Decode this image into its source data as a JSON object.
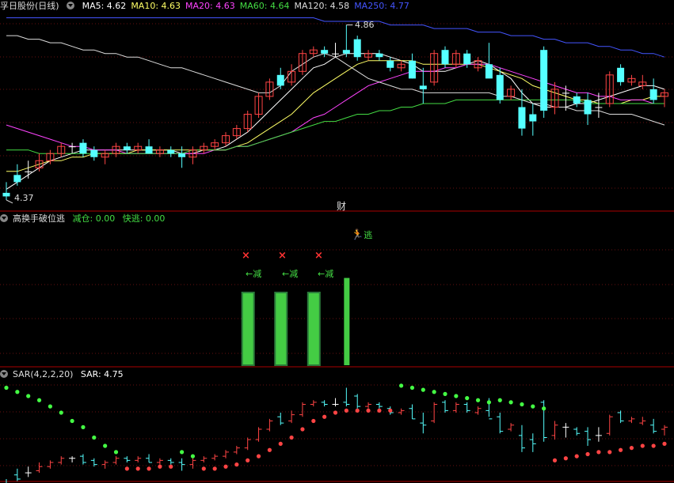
{
  "header1": {
    "title": "孚日股份(日线)",
    "ma": [
      {
        "label": "MA5: 4.62",
        "color": "#ffffff"
      },
      {
        "label": "MA10: 4.63",
        "color": "#ffff66"
      },
      {
        "label": "MA20: 4.63",
        "color": "#ff44ff"
      },
      {
        "label": "MA60: 4.64",
        "color": "#44dd44"
      },
      {
        "label": "MA120: 4.58",
        "color": "#dddddd"
      },
      {
        "label": "MA250: 4.77",
        "color": "#4455ff"
      }
    ]
  },
  "price_chart": {
    "high_label": "4.86",
    "low_label": "4.37",
    "marker_label": "财"
  },
  "header2": {
    "title": "高换手破位逃",
    "items": [
      {
        "label": "减仓: 0.00",
        "color": "#44dd44"
      },
      {
        "label": "快逃: 0.00",
        "color": "#44dd44"
      }
    ]
  },
  "indicator": {
    "escape_label": "逃",
    "reduce_label": "←减",
    "cross_symbol": "×"
  },
  "header3": {
    "title": "SAR(4,2,2,20)",
    "value_label": "SAR: 4.75"
  },
  "colors": {
    "up": "#ff4444",
    "down": "#55ffff",
    "flat": "#ffffff",
    "green": "#44cc44",
    "divider": "#aa0000"
  },
  "chart_data": {
    "type": "candlestick",
    "ohlc": [
      [
        4.39,
        4.42,
        4.37,
        4.38
      ],
      [
        4.44,
        4.47,
        4.41,
        4.42
      ],
      [
        4.45,
        4.48,
        4.43,
        4.45
      ],
      [
        4.46,
        4.5,
        4.45,
        4.48
      ],
      [
        4.48,
        4.51,
        4.47,
        4.5
      ],
      [
        4.5,
        4.53,
        4.49,
        4.52
      ],
      [
        4.52,
        4.53,
        4.5,
        4.52
      ],
      [
        4.53,
        4.54,
        4.49,
        4.5
      ],
      [
        4.51,
        4.52,
        4.48,
        4.49
      ],
      [
        4.49,
        4.51,
        4.47,
        4.5
      ],
      [
        4.5,
        4.53,
        4.49,
        4.52
      ],
      [
        4.52,
        4.53,
        4.5,
        4.51
      ],
      [
        4.51,
        4.53,
        4.5,
        4.52
      ],
      [
        4.52,
        4.54,
        4.5,
        4.5
      ],
      [
        4.5,
        4.52,
        4.49,
        4.51
      ],
      [
        4.51,
        4.52,
        4.49,
        4.5
      ],
      [
        4.5,
        4.52,
        4.46,
        4.49
      ],
      [
        4.49,
        4.52,
        4.47,
        4.51
      ],
      [
        4.51,
        4.53,
        4.5,
        4.52
      ],
      [
        4.52,
        4.54,
        4.51,
        4.53
      ],
      [
        4.53,
        4.56,
        4.52,
        4.55
      ],
      [
        4.55,
        4.58,
        4.54,
        4.57
      ],
      [
        4.57,
        4.62,
        4.56,
        4.61
      ],
      [
        4.61,
        4.67,
        4.6,
        4.66
      ],
      [
        4.66,
        4.71,
        4.65,
        4.7
      ],
      [
        4.72,
        4.74,
        4.68,
        4.69
      ],
      [
        4.7,
        4.75,
        4.69,
        4.73
      ],
      [
        4.73,
        4.79,
        4.72,
        4.78
      ],
      [
        4.78,
        4.8,
        4.77,
        4.79
      ],
      [
        4.79,
        4.8,
        4.77,
        4.78
      ],
      [
        4.78,
        4.81,
        4.77,
        4.78
      ],
      [
        4.79,
        4.86,
        4.77,
        4.78
      ],
      [
        4.82,
        4.83,
        4.76,
        4.77
      ],
      [
        4.77,
        4.79,
        4.76,
        4.78
      ],
      [
        4.78,
        4.79,
        4.76,
        4.77
      ],
      [
        4.76,
        4.77,
        4.73,
        4.74
      ],
      [
        4.74,
        4.76,
        4.73,
        4.75
      ],
      [
        4.76,
        4.78,
        4.71,
        4.71
      ],
      [
        4.69,
        4.74,
        4.64,
        4.68
      ],
      [
        4.7,
        4.79,
        4.69,
        4.78
      ],
      [
        4.79,
        4.8,
        4.74,
        4.75
      ],
      [
        4.75,
        4.79,
        4.74,
        4.78
      ],
      [
        4.78,
        4.79,
        4.74,
        4.75
      ],
      [
        4.74,
        4.77,
        4.73,
        4.76
      ],
      [
        4.75,
        4.81,
        4.72,
        4.71
      ],
      [
        4.72,
        4.74,
        4.64,
        4.65
      ],
      [
        4.66,
        4.69,
        4.65,
        4.68
      ],
      [
        4.63,
        4.68,
        4.55,
        4.57
      ],
      [
        4.61,
        4.64,
        4.55,
        4.59
      ],
      [
        4.79,
        4.8,
        4.6,
        4.62
      ],
      [
        4.63,
        4.7,
        4.61,
        4.68
      ],
      [
        4.67,
        4.69,
        4.62,
        4.67
      ],
      [
        4.66,
        4.67,
        4.63,
        4.64
      ],
      [
        4.65,
        4.67,
        4.58,
        4.61
      ],
      [
        4.63,
        4.67,
        4.6,
        4.63
      ],
      [
        4.64,
        4.73,
        4.63,
        4.72
      ],
      [
        4.74,
        4.75,
        4.69,
        4.7
      ],
      [
        4.7,
        4.72,
        4.69,
        4.71
      ],
      [
        4.69,
        4.72,
        4.68,
        4.7
      ],
      [
        4.68,
        4.71,
        4.64,
        4.65
      ],
      [
        4.66,
        4.68,
        4.63,
        4.67
      ]
    ],
    "ma": {
      "MA5": [
        4.4,
        4.42,
        4.44,
        4.46,
        4.48,
        4.49,
        4.5,
        4.51,
        4.51,
        4.51,
        4.51,
        4.51,
        4.51,
        4.51,
        4.51,
        4.51,
        4.5,
        4.5,
        4.51,
        4.51,
        4.52,
        4.54,
        4.56,
        4.59,
        4.62,
        4.65,
        4.68,
        4.71,
        4.74,
        4.75,
        4.77,
        4.78,
        4.78,
        4.78,
        4.78,
        4.77,
        4.76,
        4.75,
        4.73,
        4.73,
        4.73,
        4.74,
        4.75,
        4.76,
        4.75,
        4.73,
        4.71,
        4.67,
        4.64,
        4.63,
        4.63,
        4.63,
        4.64,
        4.64,
        4.65,
        4.66,
        4.67,
        4.68,
        4.69,
        4.69,
        4.68
      ],
      "MA10": [
        4.45,
        4.45,
        4.46,
        4.47,
        4.48,
        4.48,
        4.49,
        4.49,
        4.5,
        4.5,
        4.5,
        4.5,
        4.51,
        4.51,
        4.51,
        4.51,
        4.51,
        4.51,
        4.51,
        4.51,
        4.51,
        4.52,
        4.53,
        4.55,
        4.57,
        4.59,
        4.61,
        4.64,
        4.67,
        4.69,
        4.71,
        4.73,
        4.75,
        4.76,
        4.76,
        4.76,
        4.76,
        4.76,
        4.75,
        4.75,
        4.75,
        4.75,
        4.75,
        4.75,
        4.74,
        4.73,
        4.72,
        4.71,
        4.69,
        4.68,
        4.67,
        4.66,
        4.65,
        4.65,
        4.64,
        4.64,
        4.64,
        4.65,
        4.65,
        4.66,
        4.66
      ],
      "MA20": [
        4.58,
        4.57,
        4.56,
        4.55,
        4.54,
        4.53,
        4.52,
        4.52,
        4.51,
        4.51,
        4.51,
        4.5,
        4.5,
        4.5,
        4.5,
        4.5,
        4.5,
        4.5,
        4.5,
        4.51,
        4.51,
        4.52,
        4.52,
        4.53,
        4.54,
        4.55,
        4.56,
        4.58,
        4.6,
        4.61,
        4.63,
        4.65,
        4.67,
        4.69,
        4.7,
        4.71,
        4.72,
        4.73,
        4.73,
        4.73,
        4.74,
        4.74,
        4.75,
        4.75,
        4.75,
        4.74,
        4.73,
        4.72,
        4.71,
        4.7,
        4.69,
        4.68,
        4.67,
        4.67,
        4.66,
        4.66,
        4.65,
        4.65,
        4.65,
        4.64,
        4.64
      ],
      "MA60": [
        4.51,
        4.51,
        4.51,
        4.5,
        4.5,
        4.5,
        4.5,
        4.5,
        4.5,
        4.5,
        4.5,
        4.5,
        4.5,
        4.5,
        4.5,
        4.5,
        4.5,
        4.51,
        4.51,
        4.51,
        4.51,
        4.52,
        4.52,
        4.53,
        4.54,
        4.55,
        4.56,
        4.57,
        4.58,
        4.59,
        4.59,
        4.6,
        4.61,
        4.61,
        4.62,
        4.62,
        4.63,
        4.63,
        4.64,
        4.64,
        4.64,
        4.65,
        4.65,
        4.65,
        4.65,
        4.65,
        4.65,
        4.65,
        4.65,
        4.65,
        4.65,
        4.65,
        4.65,
        4.64,
        4.64,
        4.64,
        4.64,
        4.64,
        4.64,
        4.64,
        4.64
      ],
      "MA120": [
        4.83,
        4.83,
        4.82,
        4.82,
        4.81,
        4.81,
        4.8,
        4.79,
        4.79,
        4.78,
        4.78,
        4.77,
        4.77,
        4.76,
        4.75,
        4.74,
        4.74,
        4.73,
        4.72,
        4.71,
        4.7,
        4.69,
        4.68,
        4.67,
        4.67,
        4.69,
        4.73,
        4.75,
        4.77,
        4.78,
        4.77,
        4.75,
        4.73,
        4.71,
        4.7,
        4.69,
        4.68,
        4.68,
        4.67,
        4.67,
        4.67,
        4.67,
        4.67,
        4.67,
        4.67,
        4.66,
        4.66,
        4.65,
        4.64,
        4.64,
        4.63,
        4.63,
        4.62,
        4.62,
        4.62,
        4.61,
        4.61,
        4.61,
        4.6,
        4.59,
        4.58
      ],
      "MA250": [
        4.88,
        4.88,
        4.88,
        4.88,
        4.88,
        4.88,
        4.88,
        4.88,
        4.88,
        4.88,
        4.88,
        4.88,
        4.88,
        4.88,
        4.88,
        4.88,
        4.88,
        4.88,
        4.88,
        4.88,
        4.88,
        4.88,
        4.88,
        4.88,
        4.88,
        4.88,
        4.88,
        4.88,
        4.88,
        4.87,
        4.87,
        4.87,
        4.87,
        4.87,
        4.87,
        4.86,
        4.86,
        4.86,
        4.86,
        4.85,
        4.85,
        4.85,
        4.85,
        4.84,
        4.84,
        4.84,
        4.83,
        4.83,
        4.83,
        4.82,
        4.82,
        4.81,
        4.81,
        4.81,
        4.8,
        4.8,
        4.79,
        4.79,
        4.78,
        4.78,
        4.77
      ]
    },
    "indicator_bars": [
      {
        "index": 22,
        "value": 1.0,
        "type": "reduce"
      },
      {
        "index": 25,
        "value": 1.0,
        "type": "reduce"
      },
      {
        "index": 28,
        "value": 1.0,
        "type": "reduce"
      },
      {
        "index": 31,
        "value": 1.2,
        "type": "escape"
      }
    ],
    "sar": [
      [
        4.86,
        "d"
      ],
      [
        4.84,
        "d"
      ],
      [
        4.82,
        "d"
      ],
      [
        4.8,
        "d"
      ],
      [
        4.77,
        "d"
      ],
      [
        4.74,
        "d"
      ],
      [
        4.7,
        "d"
      ],
      [
        4.67,
        "d"
      ],
      [
        4.62,
        "d"
      ],
      [
        4.58,
        "d"
      ],
      [
        4.55,
        "d"
      ],
      [
        4.47,
        "u"
      ],
      [
        4.47,
        "u"
      ],
      [
        4.47,
        "u"
      ],
      [
        4.48,
        "u"
      ],
      [
        4.48,
        "u"
      ],
      [
        4.55,
        "d"
      ],
      [
        4.53,
        "d"
      ],
      [
        4.47,
        "u"
      ],
      [
        4.47,
        "u"
      ],
      [
        4.48,
        "u"
      ],
      [
        4.49,
        "u"
      ],
      [
        4.51,
        "u"
      ],
      [
        4.53,
        "u"
      ],
      [
        4.56,
        "u"
      ],
      [
        4.59,
        "u"
      ],
      [
        4.62,
        "u"
      ],
      [
        4.66,
        "u"
      ],
      [
        4.7,
        "u"
      ],
      [
        4.72,
        "u"
      ],
      [
        4.74,
        "u"
      ],
      [
        4.75,
        "u"
      ],
      [
        4.75,
        "u"
      ],
      [
        4.75,
        "u"
      ],
      [
        4.75,
        "u"
      ],
      [
        4.75,
        "u"
      ],
      [
        4.87,
        "d"
      ],
      [
        4.86,
        "d"
      ],
      [
        4.85,
        "d"
      ],
      [
        4.84,
        "d"
      ],
      [
        4.83,
        "d"
      ],
      [
        4.82,
        "d"
      ],
      [
        4.81,
        "d"
      ],
      [
        4.8,
        "d"
      ],
      [
        4.79,
        "d"
      ],
      [
        4.8,
        "d"
      ],
      [
        4.79,
        "d"
      ],
      [
        4.78,
        "d"
      ],
      [
        4.77,
        "d"
      ],
      [
        4.76,
        "d"
      ],
      [
        4.51,
        "u"
      ],
      [
        4.52,
        "u"
      ],
      [
        4.53,
        "u"
      ],
      [
        4.54,
        "u"
      ],
      [
        4.55,
        "u"
      ],
      [
        4.55,
        "u"
      ],
      [
        4.56,
        "u"
      ],
      [
        4.57,
        "u"
      ],
      [
        4.58,
        "u"
      ],
      [
        4.58,
        "u"
      ],
      [
        4.59,
        "u"
      ]
    ],
    "ylim_price": [
      4.35,
      4.89
    ],
    "ylim_sar": [
      4.42,
      4.9
    ]
  }
}
